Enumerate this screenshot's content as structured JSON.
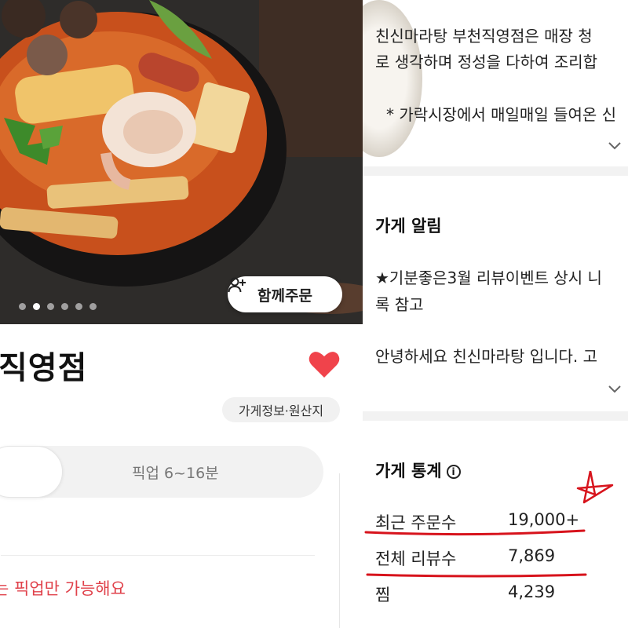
{
  "left": {
    "hero": {
      "carousel_count": 6,
      "carousel_active_index": 1,
      "group_order_label": "함께주문"
    },
    "store_name": "직영점",
    "info_chip_label": "가게정보·원산지",
    "pickup_tab": {
      "label": "픽업",
      "time": "6~16분"
    },
    "pickup_note": "는 픽업만 가능해요",
    "colors": {
      "heart": "#f0434b",
      "note": "#e0424b"
    }
  },
  "right": {
    "intro_line1": "친신마라탕 부천직영점은  매장 청",
    "intro_line2": "로 생각하며 정성을 다하여 조리합",
    "intro_line3": "* 가락시장에서 매일매일 들여온 신",
    "notice": {
      "title": "가게 알림",
      "line1": "★기분좋은3월 리뷰이벤트 상시 니",
      "line2": "록 참고",
      "line3": "안녕하세요 친신마라탕 입니다.  고"
    },
    "stats": {
      "title": "가게 통계",
      "info_icon": "i",
      "rows": [
        {
          "label": "최근 주문수",
          "value": "19,000+"
        },
        {
          "label": "전체 리뷰수",
          "value": "7,869"
        },
        {
          "label": "찜",
          "value": "4,239"
        }
      ]
    },
    "annotation_color": "#d7131c"
  }
}
